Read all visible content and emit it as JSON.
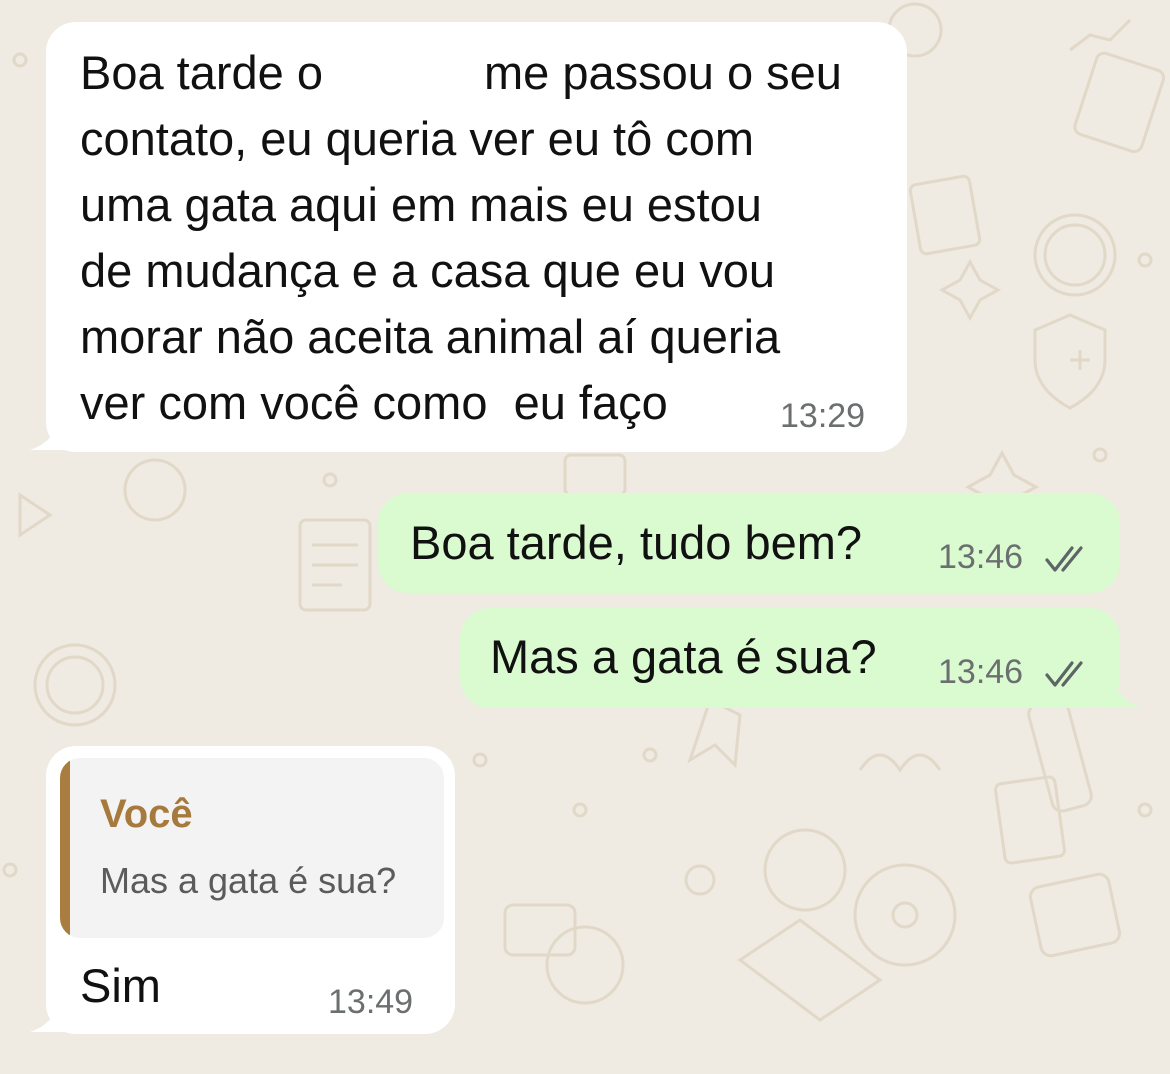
{
  "chat": {
    "background_color": "#efeae2",
    "incoming_bubble_color": "#ffffff",
    "outgoing_bubble_color": "#dafbd0",
    "read_ticks_icon": "double-check-icon",
    "messages": [
      {
        "direction": "incoming",
        "lines": [
          "Boa tarde o",
          "me passou o seu",
          "contato, eu queria ver eu tô com",
          "uma gata aqui em mais eu estou",
          "de mudança e a casa que eu vou",
          "morar não aceita animal aí queria",
          "ver com você como  eu faço"
        ],
        "time": "13:29"
      },
      {
        "direction": "outgoing",
        "text": "Boa tarde, tudo bem?",
        "time": "13:46",
        "status": "read"
      },
      {
        "direction": "outgoing",
        "text": "Mas a gata é sua?",
        "time": "13:46",
        "status": "read"
      },
      {
        "direction": "incoming",
        "reply_to": {
          "author": "Você",
          "text": "Mas a gata é sua?",
          "accent_color": "#a87d3f"
        },
        "text": "Sim",
        "time": "13:49"
      }
    ]
  }
}
